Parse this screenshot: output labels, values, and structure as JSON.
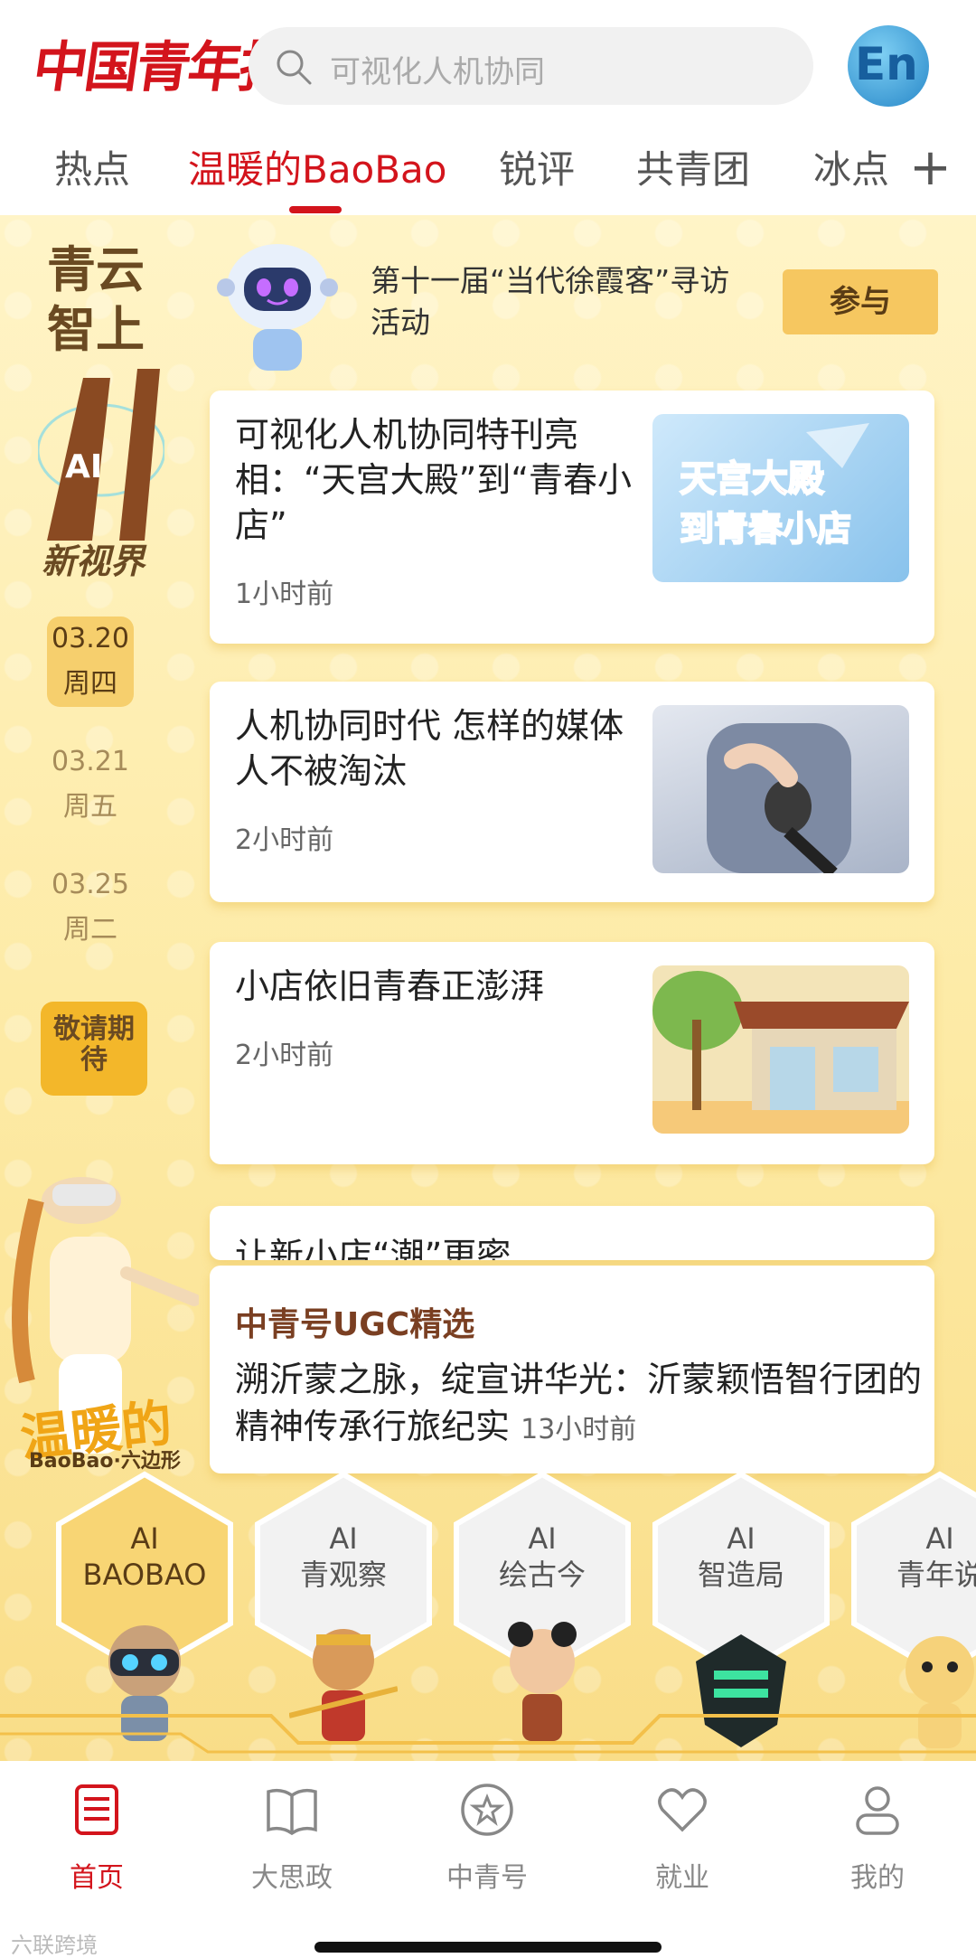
{
  "header": {
    "logo_text": "中国青年报",
    "search_placeholder": "可视化人机协同",
    "lang_button": "En"
  },
  "tabs": [
    {
      "label": "热点",
      "active": false
    },
    {
      "label": "温暖的BaoBao",
      "active": true
    },
    {
      "label": "锐评",
      "active": false
    },
    {
      "label": "共青团",
      "active": false
    },
    {
      "label": "冰点",
      "active": false
    }
  ],
  "tab_plus": "+",
  "left_promo": {
    "title_line1": "青云",
    "title_line2": "智上",
    "ai_mark": "AI",
    "subtitle": "新视界",
    "dates": [
      {
        "date": "03.20",
        "weekday": "周四",
        "active": true
      },
      {
        "date": "03.21",
        "weekday": "周五",
        "active": false
      },
      {
        "date": "03.25",
        "weekday": "周二",
        "active": false
      }
    ],
    "coming_soon": "敬请期待",
    "brand": "温暖的",
    "brand_sub": "BaoBao·六边形"
  },
  "event": {
    "text": "第十一届“当代徐霞客”寻访活动",
    "button": "参与"
  },
  "news": [
    {
      "title": "可视化人机协同特刊亮相：“天宫大殿”到“青春小店”",
      "time": "1小时前",
      "thumb_text": "天宫大殿到青春小店"
    },
    {
      "title": "人机协同时代 怎样的媒体人不被淘汰",
      "time": "2小时前"
    },
    {
      "title": "小店依旧青春正澎湃",
      "time": "2小时前"
    }
  ],
  "partial_card_title": "让新小店“潮”更密",
  "ugc": {
    "heading": "中青号UGC精选",
    "text": "溯沂蒙之脉，绽宣讲华光：沂蒙颖悟智行团的精神传承行旅纪实",
    "time": "13小时前"
  },
  "hex_items": [
    {
      "line1": "AI",
      "line2": "BAOBAO",
      "active": true
    },
    {
      "line1": "AI",
      "line2": "青观察",
      "active": false
    },
    {
      "line1": "AI",
      "line2": "绘古今",
      "active": false
    },
    {
      "line1": "AI",
      "line2": "智造局",
      "active": false
    },
    {
      "line1": "AI",
      "line2": "青年说",
      "active": false
    }
  ],
  "bottom_nav": [
    {
      "label": "首页",
      "icon": "news-icon",
      "active": true
    },
    {
      "label": "大思政",
      "icon": "book-icon",
      "active": false
    },
    {
      "label": "中青号",
      "icon": "star-icon",
      "active": false
    },
    {
      "label": "就业",
      "icon": "heart-icon",
      "active": false
    },
    {
      "label": "我的",
      "icon": "user-icon",
      "active": false
    }
  ],
  "watermark": "六联跨境",
  "colors": {
    "brand_red": "#d3141c",
    "gold": "#f3b72a",
    "cream": "#fff4c7"
  }
}
